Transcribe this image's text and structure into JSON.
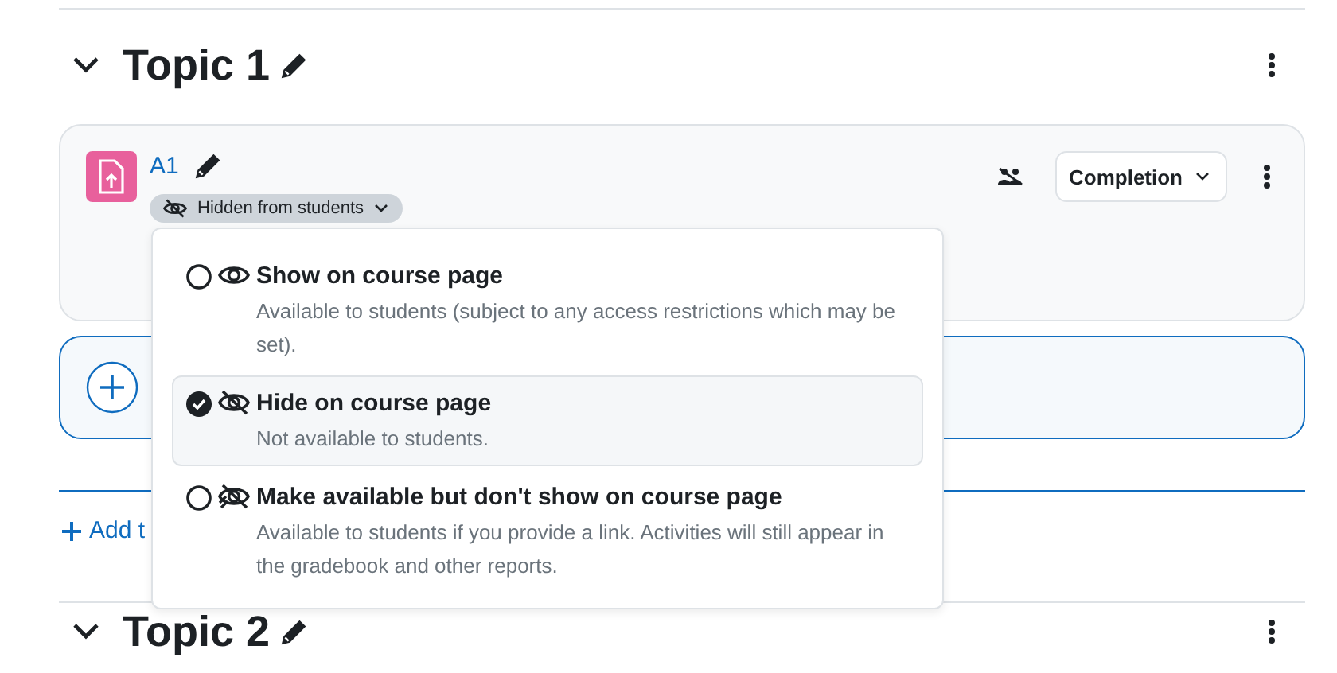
{
  "topic": {
    "title": "Topic 1",
    "expanded": true
  },
  "activity": {
    "name": "A1",
    "visibility_badge": "Hidden from students",
    "completion_button": "Completion"
  },
  "add_topic_link": "Add t",
  "visibility_menu": {
    "options": [
      {
        "kind": "show",
        "title": "Show on course page",
        "description": "Available to students (subject to any access restrictions which may be set).",
        "selected": false
      },
      {
        "kind": "hide",
        "title": "Hide on course page",
        "description": "Not available to students.",
        "selected": true
      },
      {
        "kind": "stealth",
        "title": "Make available but don't show on course page",
        "description": "Available to students if you provide a link. Activities will still appear in the gradebook and other reports.",
        "selected": false
      }
    ]
  },
  "next_topic": {
    "title": "Topic 2",
    "expanded": true
  }
}
